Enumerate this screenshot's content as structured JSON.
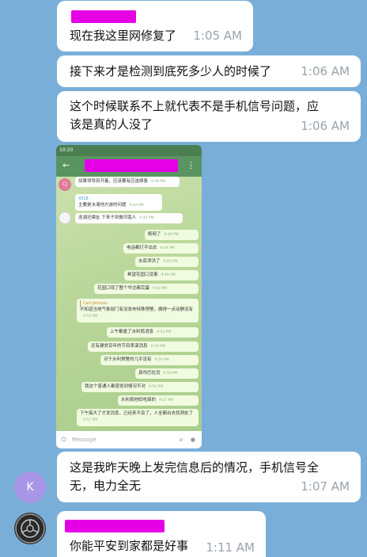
{
  "messages": [
    {
      "text": "现在我这里网修复了",
      "time": "1:05 AM"
    },
    {
      "text": "接下来才是检测到底死多少人的时候了",
      "time": "1:06 AM"
    },
    {
      "text": "这个时候联系不上就代表不是手机信号问题，应该是真的人没了",
      "time": "1:06 AM"
    },
    {
      "text": "这是我昨天晚上发完信息后的情况，手机信号全无，电力全无",
      "time": "1:07 AM"
    },
    {
      "text": "你能平安到家都是好事",
      "time": "1:11 AM"
    }
  ],
  "avatars": {
    "k_letter": "K",
    "k_color": "#a995e6"
  },
  "colors": {
    "background": "#79aed9",
    "redaction": "#e600e6",
    "time": "#9aa3ab"
  },
  "phone": {
    "status_time": "10:20",
    "compose_placeholder": "Message",
    "incoming": [
      {
        "avatar": "CJ",
        "text": "如果领导到开着，应该要有应选择客",
        "time": "9:40 PM"
      },
      {
        "name": "4318",
        "text": "主要是水淹地方游的问题",
        "time": "9:42 PM"
      },
      {
        "text": "连湖还摸扯 下来子到做河南人",
        "time": "9:45 PM"
      }
    ],
    "outgoing": [
      {
        "text": "断网了",
        "time": "9:49 PM"
      },
      {
        "text": "电话都打不出去",
        "time": "9:49 PM"
      },
      {
        "text": "水库泄洪了",
        "time": "9:49 PM"
      },
      {
        "text": "希望花园口没事",
        "time": "9:49 PM"
      },
      {
        "text": "花园口垮了整个华北都完蛋",
        "time": "9:50 PM"
      },
      {
        "reply_name": "Carl Johnson",
        "text": "不知道当地气象部门有没发布特殊预警，搁得一点动静没有",
        "time": "9:53 PM"
      },
      {
        "text": "上午都垂了水利局消息",
        "time": "9:53 PM"
      },
      {
        "text": "还有建党百年的节目表演消息",
        "time": "9:56 PM"
      },
      {
        "text": "对于水利预警的几乎没有",
        "time": "9:56 PM"
      },
      {
        "text": "真吗巴拉没",
        "time": "9:56 PM"
      },
      {
        "text": "我这个普通人都感觉到情况不对",
        "time": "9:56 PM"
      },
      {
        "text": "水利局他妈吃屎的",
        "time": "9:57 PM"
      },
      {
        "text": "下午搞大了才发消息，已经来不及了，人全都出去找洞处了",
        "time": "9:57 PM"
      }
    ]
  }
}
